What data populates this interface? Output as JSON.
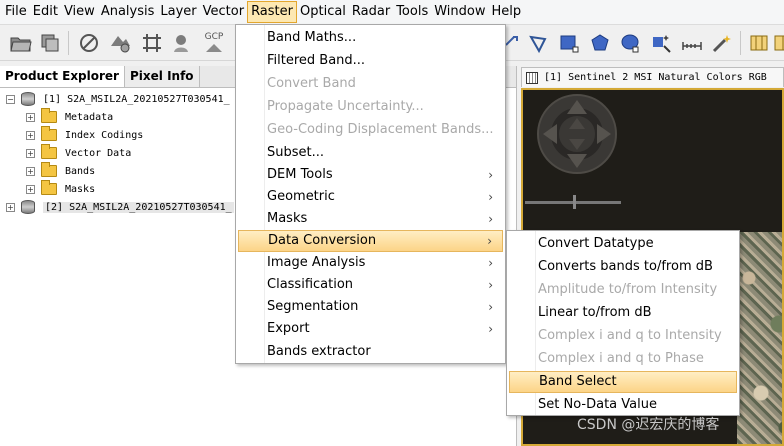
{
  "menubar": {
    "items": [
      "File",
      "Edit",
      "View",
      "Analysis",
      "Layer",
      "Vector",
      "Raster",
      "Optical",
      "Radar",
      "Tools",
      "Window",
      "Help"
    ],
    "active": "Raster"
  },
  "toolbar": {
    "gcp_label": "GCP"
  },
  "left_panel": {
    "tabs": [
      "Product Explorer",
      "Pixel Info"
    ],
    "tree": {
      "product1": "[1] S2A_MSIL2A_20210527T030541_",
      "children": [
        "Metadata",
        "Index Codings",
        "Vector Data",
        "Bands",
        "Masks"
      ],
      "product2": "[2] S2A_MSIL2A_20210527T030541_"
    }
  },
  "right_panel": {
    "tab_label": "[1] Sentinel 2 MSI Natural Colors RGB"
  },
  "raster_menu": {
    "items": [
      {
        "label": "Band Maths...",
        "disabled": false,
        "submenu": false
      },
      {
        "label": "Filtered Band...",
        "disabled": false,
        "submenu": false
      },
      {
        "label": "Convert Band",
        "disabled": true,
        "submenu": false
      },
      {
        "label": "Propagate Uncertainty...",
        "disabled": true,
        "submenu": false
      },
      {
        "label": "Geo-Coding Displacement Bands...",
        "disabled": true,
        "submenu": false
      },
      {
        "label": "Subset...",
        "disabled": false,
        "submenu": false
      },
      {
        "label": "DEM Tools",
        "disabled": false,
        "submenu": true
      },
      {
        "label": "Geometric",
        "disabled": false,
        "submenu": true
      },
      {
        "label": "Masks",
        "disabled": false,
        "submenu": true
      },
      {
        "label": "Data Conversion",
        "disabled": false,
        "submenu": true
      },
      {
        "label": "Image Analysis",
        "disabled": false,
        "submenu": true
      },
      {
        "label": "Classification",
        "disabled": false,
        "submenu": true
      },
      {
        "label": "Segmentation",
        "disabled": false,
        "submenu": true
      },
      {
        "label": "Export",
        "disabled": false,
        "submenu": true
      },
      {
        "label": "Bands extractor",
        "disabled": false,
        "submenu": false
      }
    ],
    "highlighted": "Data Conversion"
  },
  "conversion_menu": {
    "items": [
      {
        "label": "Convert Datatype",
        "disabled": false
      },
      {
        "label": "Converts bands to/from dB",
        "disabled": false
      },
      {
        "label": "Amplitude to/from Intensity",
        "disabled": true
      },
      {
        "label": "Linear to/from dB",
        "disabled": false
      },
      {
        "label": "Complex i and q to Intensity",
        "disabled": true
      },
      {
        "label": "Complex i and q to Phase",
        "disabled": true
      },
      {
        "label": "Band Select",
        "disabled": false
      },
      {
        "label": "Set No-Data Value",
        "disabled": false
      }
    ],
    "highlighted": "Band Select"
  },
  "watermark": "CSDN @迟宏庆的博客",
  "colors": {
    "highlight_top": "#ffeec4",
    "highlight_bottom": "#fcd487",
    "highlight_border": "#e6b65d",
    "disabled_text": "#a9a9a9",
    "view_border": "#d4a937"
  }
}
